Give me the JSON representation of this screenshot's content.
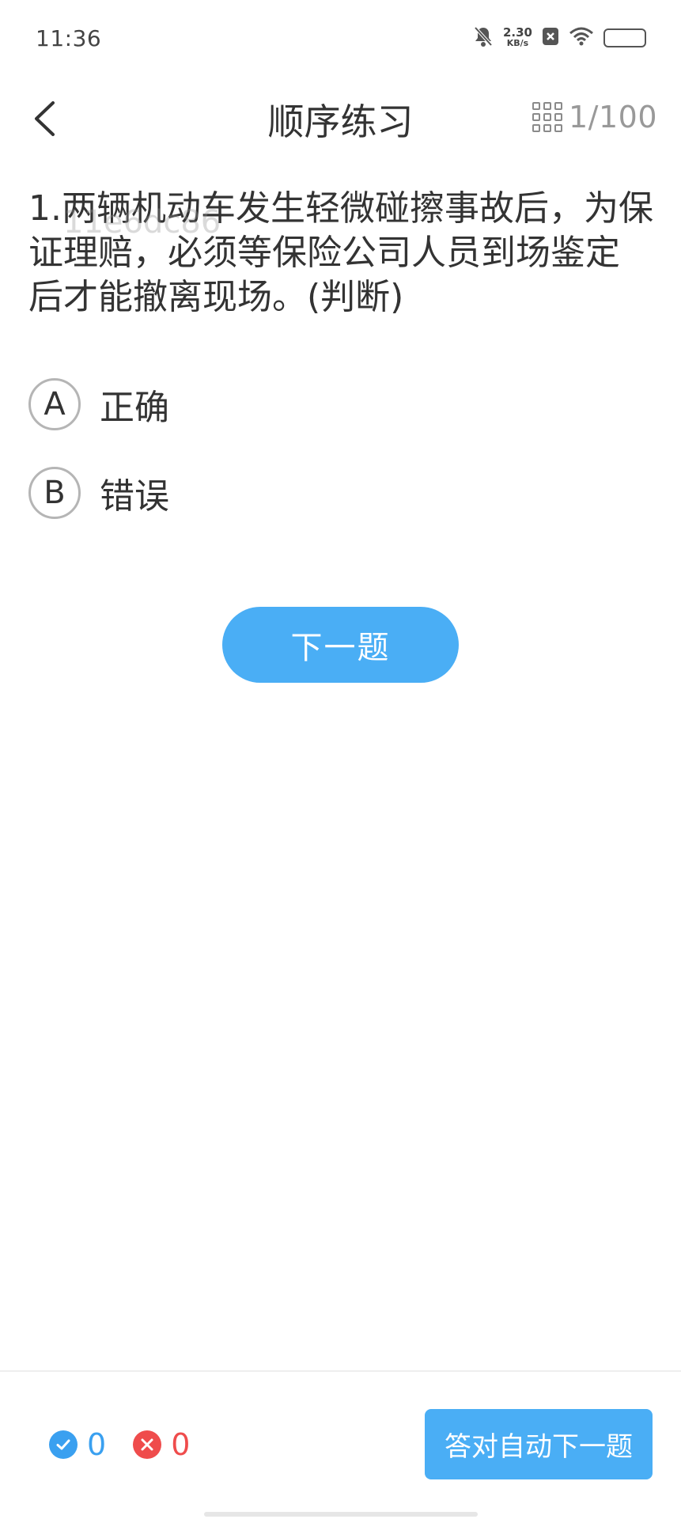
{
  "status_bar": {
    "time": "11:36",
    "net_speed_value": "2.30",
    "net_speed_unit": "KB/s",
    "icons": [
      "bell-off-icon",
      "notification-x-icon",
      "wifi-icon",
      "battery-icon"
    ]
  },
  "header": {
    "back_icon": "chevron-left-icon",
    "title": "顺序练习",
    "grid_icon": "grid-icon",
    "progress": "1/100"
  },
  "question": {
    "text": "1.两辆机动车发生轻微碰擦事故后，为保证理赔，必须等保险公司人员到场鉴定后才能撤离现场。(判断)",
    "watermark": "11e6dc86"
  },
  "options": [
    {
      "letter": "A",
      "text": "正确"
    },
    {
      "letter": "B",
      "text": "错误"
    }
  ],
  "next_button": "下一题",
  "footer": {
    "correct_count": "0",
    "wrong_count": "0",
    "auto_next_label": "答对自动下一题"
  },
  "colors": {
    "accent": "#4aaef5",
    "correct": "#3aa0f0",
    "wrong": "#ef4c4c"
  }
}
